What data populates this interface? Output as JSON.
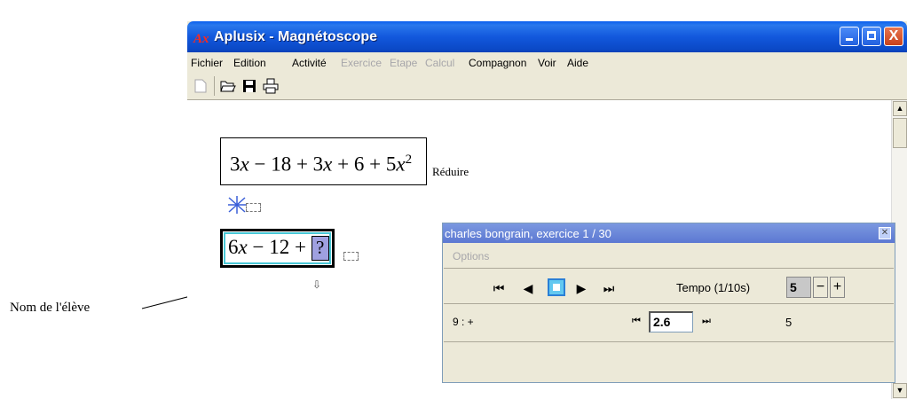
{
  "annotation": {
    "label": "Nom de l'élève"
  },
  "window": {
    "title": "Aplusix - Magnétoscope",
    "icon_text": "Ax",
    "close_glyph": "X"
  },
  "menu": [
    {
      "label": "Fichier",
      "enabled": true
    },
    {
      "label": "Edition",
      "enabled": true
    },
    {
      "label": "Activité",
      "enabled": true
    },
    {
      "label": "Exercice",
      "enabled": false
    },
    {
      "label": "Etape",
      "enabled": false
    },
    {
      "label": "Calcul",
      "enabled": false
    },
    {
      "label": "Compagnon",
      "enabled": true
    },
    {
      "label": "Voir",
      "enabled": true
    },
    {
      "label": "Aide",
      "enabled": true
    }
  ],
  "toolbar": {
    "new_icon": "new-document-icon",
    "open_icon": "open-folder-icon",
    "save_icon": "save-disk-icon",
    "print_icon": "printer-icon"
  },
  "workspace": {
    "expression1": {
      "a": "3",
      "b": "x",
      "c": " − 18 + 3",
      "d": "x",
      "e": " + 6 + 5",
      "f": "x",
      "exp": "2"
    },
    "action_label": "Réduire",
    "expression2": {
      "a": "6",
      "b": "x",
      "c": " − 12 + ",
      "placeholder": "?"
    },
    "colors": {
      "selection_border": "#47c7d6",
      "placeholder_fill": "#9fa0e0",
      "step_icon": "#3a5fd8"
    }
  },
  "player": {
    "title": "charles bongrain,  exercice 1 / 30",
    "close_glyph": "✕",
    "options_label": "Options",
    "controls": {
      "first": "⏮",
      "prev": "◀",
      "next": "▶",
      "last": "⏭"
    },
    "tempo_label": "Tempo (1/10s)",
    "tempo_value": "5",
    "minus": "−",
    "plus": "+",
    "step_label": "9 : +",
    "nav_prev": "⏮",
    "time_value": "2.6",
    "nav_next": "⏭",
    "right_value": "5"
  }
}
